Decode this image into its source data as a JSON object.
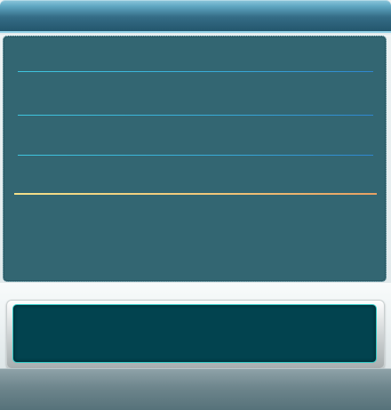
{
  "window": {
    "title": ""
  },
  "panel": {
    "rows": [
      {
        "label": "",
        "style": "blue"
      },
      {
        "label": "",
        "style": "blue"
      },
      {
        "label": "",
        "style": "blue"
      },
      {
        "label": "",
        "style": "gold"
      }
    ]
  },
  "input": {
    "value": "",
    "placeholder": ""
  },
  "colors": {
    "title_bar": "#2f6680",
    "panel_bg": "#336672",
    "row_line": "#38a9d8",
    "highlight_line": "#f1c77a",
    "input_bg": "#02434f",
    "input_border": "#30c9c5",
    "footer": "#6d858c"
  }
}
